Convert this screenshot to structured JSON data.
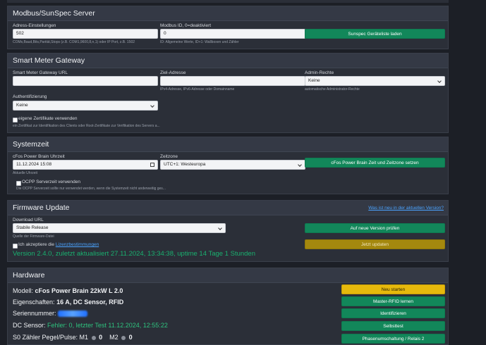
{
  "modbus": {
    "title": "Modbus/SunSpec Server",
    "address_label": "Adress-Einstellungen",
    "address_value": "502",
    "address_help": "COMx,Baud,Bits,Parität,Stops (z.B. COM1,9600,8,n,1) oder IP Port, z.B. 1502",
    "id_label": "Modbus ID, 0=deaktiviert",
    "id_value": "0",
    "id_help": "ID: Allgemeine Werte, ID+1: Wallboxen und Zähler",
    "load_button": "Sunspec Geräteliste laden"
  },
  "gateway": {
    "title": "Smart Meter Gateway",
    "url_label": "Smart Meter Gateway URL",
    "url_value": "",
    "target_label": "Ziel-Adresse",
    "target_value": "",
    "target_help": "IPv4-Adresse, IPv6-Adresse oder Domainname",
    "admin_label": "Admin-Rechte",
    "admin_value": "Keine",
    "admin_help": "automatische Administrator-Rechte",
    "auth_label": "Authentifizierung",
    "auth_value": "Keine",
    "own_cert_label": "eigene Zertifikate verwenden",
    "own_cert_help": "ein Zertifikat zur Identifikation des Clients oder Root-Zertifikate zur Verifikation des Servers a..."
  },
  "systime": {
    "title": "Systemzeit",
    "clock_label": "cFos Power Brain Uhrzeit",
    "clock_value": "11.12.2024 15:08",
    "clock_help": "Aktuelle Uhrzeit",
    "zone_label": "Zeitzone",
    "zone_value": "UTC+1: Westeuropa",
    "set_button": "cFos Power Brain Zeit und Zeitzone setzen",
    "ocpp_label": "OCPP Serverzeit verwenden",
    "ocpp_help": "Die OCPP Serverzeit sollte nur verwendet werden, wenn die Systemzeit nicht anderweitig ges..."
  },
  "firmware": {
    "title": "Firmware Update",
    "whats_new": "Was ist neu in der aktuellen Version?",
    "url_label": "Download URL",
    "url_value": "Stabile Release",
    "url_help": "Quelle der Firmware-Datei",
    "check_button": "Auf neue Version prüfen",
    "accept_prefix": "Ich akzeptiere die",
    "accept_link": "Lizenzbestimmungen",
    "update_button": "Jetzt updaten",
    "version_text": "Version 2.4.0, zuletzt aktualisiert 27.11.2024, 13:34:38, uptime 14 Tage 1 Stunden"
  },
  "hardware": {
    "title": "Hardware",
    "model_label": "Modell:",
    "model_value": "cFos Power Brain 22kW L 2.0",
    "props_label": "Eigenschaften:",
    "props_value": "16 A, DC Sensor, RFID",
    "serial_label": "Seriennummer:",
    "dc_label": "DC Sensor:",
    "dc_value": "Fehler: 0, letzter Test 11.12.2024, 12:55:22",
    "s0_label": "S0 Zähler Pegel/Pulse: M1",
    "m1_value": "0",
    "m2_label": "M2",
    "m2_value": "0",
    "restart_button": "Neu starten",
    "rfid_button": "Master-RFID lernen",
    "identify_button": "Identifizieren",
    "selftest_button": "Selbsttest",
    "phase_button": "Phasenumschaltung / Relais 2"
  },
  "colors": {
    "background": "#1c1f26",
    "panel": "#2b2f38",
    "primary_green": "#12875a",
    "warning_yellow": "#e6b90c",
    "update_olive": "#a4880e",
    "version_green": "#19b06f",
    "link_blue": "#4aa3ff"
  },
  "icons": {
    "calendar": "calendar-icon",
    "dropdown": "chevron-down-icon",
    "status_dot": "status-dot-icon"
  }
}
